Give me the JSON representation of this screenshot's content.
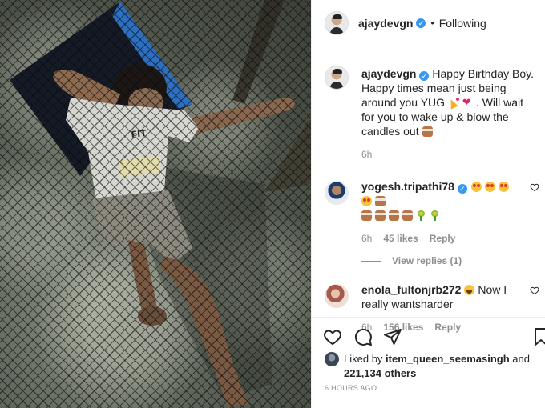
{
  "post": {
    "username": "ajaydevgn",
    "separator": "•",
    "follow_state": "Following"
  },
  "caption": {
    "username": "ajaydevgn",
    "text_part1": "Happy Birthday Boy. Happy times mean just being around you YUG",
    "text_part2": ". Will wait for you to wake up & blow the candles out",
    "time": "6h"
  },
  "comments": [
    {
      "username": "yogesh.tripathi78",
      "emoji_line1": [
        "star-struck",
        "star-struck",
        "star-struck",
        "star-struck",
        "cake"
      ],
      "emoji_line2": [
        "cake",
        "cake",
        "cake",
        "cake",
        "bouquet",
        "bouquet"
      ],
      "time": "6h",
      "likes": "45 likes",
      "reply_label": "Reply",
      "view_replies": "View replies (1)"
    },
    {
      "username": "enola_fultonjrb272",
      "text": "Now I really wantsharder",
      "emoji": "laughing",
      "time": "6h",
      "likes": "156 likes",
      "reply_label": "Reply"
    }
  ],
  "likes": {
    "prefix": "Liked by",
    "user": "item_queen_seemasingh",
    "and": "and",
    "count": "221,134 others"
  },
  "timestamp": "6 HOURS AGO",
  "icons": {
    "like": "heart-outline-icon",
    "comment": "comment-bubble-icon",
    "share": "paper-plane-icon",
    "save": "bookmark-icon",
    "verified": "verified-badge-icon"
  },
  "colors": {
    "verified": "#3897f0",
    "text": "#262626",
    "muted": "#8e8e8e"
  }
}
